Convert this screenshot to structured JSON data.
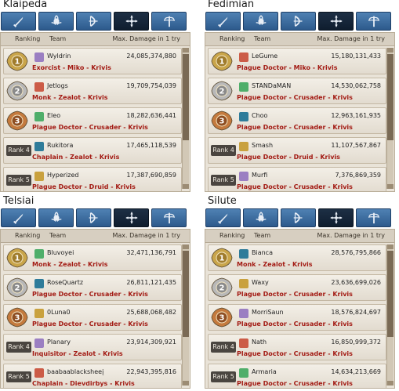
{
  "tab_icons": [
    "sword-icon",
    "fireball-icon",
    "bow-icon",
    "cross-arrows-icon",
    "staff-wings-icon"
  ],
  "header": {
    "ranking": "Ranking",
    "team": "Team",
    "damage": "Max. Damage in 1 try"
  },
  "rank_labels": [
    "1",
    "2",
    "3",
    "Rank 4",
    "Rank 5"
  ],
  "servers": [
    {
      "name": "Klaipeda",
      "entries": [
        {
          "player": "Wyldrin",
          "damage": "24,085,374,880",
          "classes": "Exorcist - Miko - Krivis"
        },
        {
          "player": "Jetlogs",
          "damage": "19,709,754,039",
          "classes": "Monk - Zealot - Krivis"
        },
        {
          "player": "Eleo",
          "damage": "18,282,636,441",
          "classes": "Plague Doctor - Crusader - Krivis"
        },
        {
          "player": "Rukitora",
          "damage": "17,465,118,539",
          "classes": "Chaplain - Zealot - Krivis"
        },
        {
          "player": "Hyperized",
          "damage": "17,387,690,859",
          "classes": "Plague Doctor - Druid - Krivis"
        }
      ]
    },
    {
      "name": "Fedimian",
      "entries": [
        {
          "player": "LeGume",
          "damage": "15,180,131,433",
          "classes": "Plague Doctor - Miko - Krivis"
        },
        {
          "player": "STANDaMAN",
          "damage": "14,530,062,758",
          "classes": "Plague Doctor - Crusader - Krivis"
        },
        {
          "player": "Choo",
          "damage": "12,963,161,935",
          "classes": "Plague Doctor - Crusader - Krivis"
        },
        {
          "player": "Smash",
          "damage": "11,107,567,867",
          "classes": "Plague Doctor - Druid - Krivis"
        },
        {
          "player": "Murfi",
          "damage": "7,376,869,359",
          "classes": "Plague Doctor - Crusader - Krivis"
        }
      ]
    },
    {
      "name": "Telsiai",
      "entries": [
        {
          "player": "Bluvoyei",
          "damage": "32,471,136,791",
          "classes": "Monk - Zealot - Krivis"
        },
        {
          "player": "RoseQuartz",
          "damage": "26,811,121,435",
          "classes": "Plague Doctor - Crusader - Krivis"
        },
        {
          "player": "0Luna0",
          "damage": "25,688,068,482",
          "classes": "Plague Doctor - Crusader - Krivis"
        },
        {
          "player": "Planary",
          "damage": "23,914,309,921",
          "classes": "Inquisitor - Zealot - Krivis"
        },
        {
          "player": "baabaablacksheeį",
          "damage": "22,943,395,816",
          "classes": "Chaplain - Dievdirbys - Krivis"
        }
      ]
    },
    {
      "name": "Silute",
      "entries": [
        {
          "player": "Bianca",
          "damage": "28,576,795,866",
          "classes": "Monk - Zealot - Krivis"
        },
        {
          "player": "Waxy",
          "damage": "23,636,699,026",
          "classes": "Plague Doctor - Crusader - Krivis"
        },
        {
          "player": "MorriSaun",
          "damage": "18,576,824,697",
          "classes": "Plague Doctor - Crusader - Krivis"
        },
        {
          "player": "Nath",
          "damage": "16,850,999,372",
          "classes": "Plague Doctor - Crusader - Krivis"
        },
        {
          "player": "Armaria",
          "damage": "14,634,213,669",
          "classes": "Plague Doctor - Crusader - Krivis"
        }
      ]
    }
  ]
}
